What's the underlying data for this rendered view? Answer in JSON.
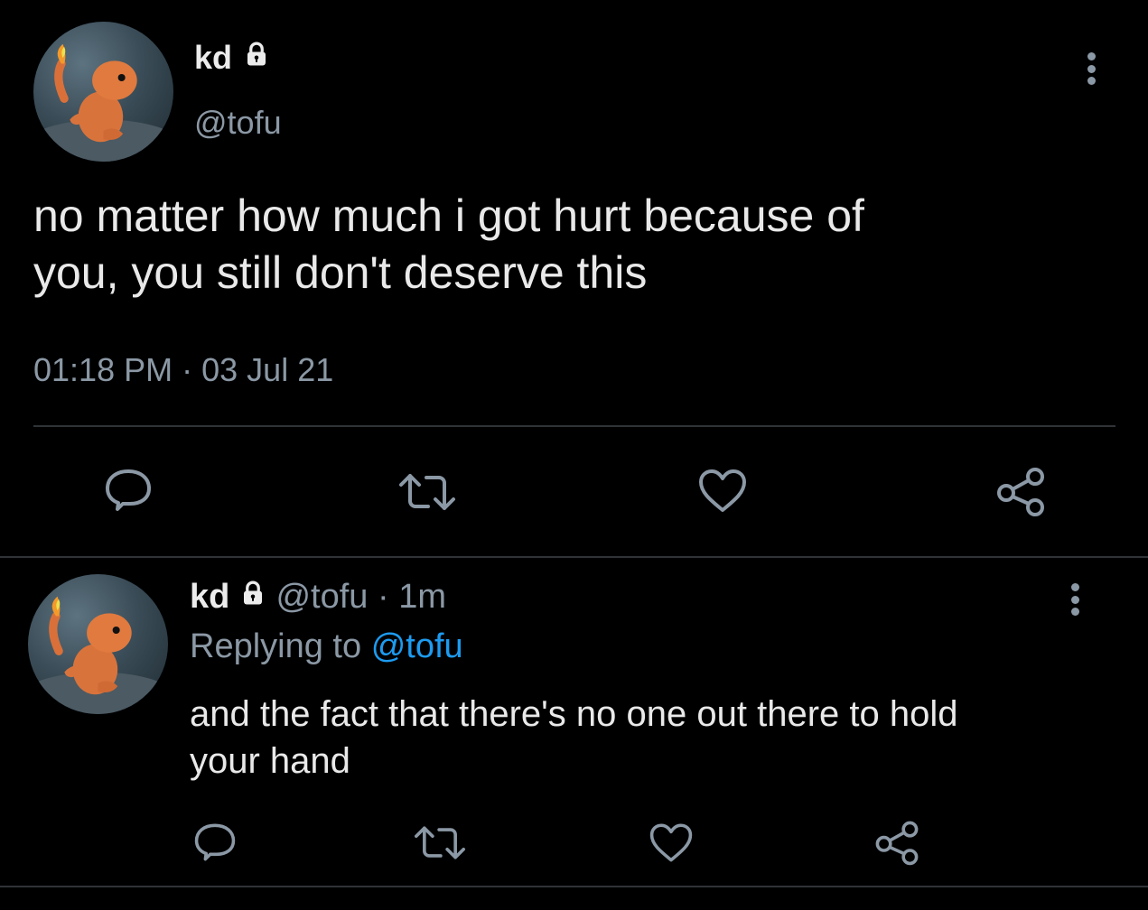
{
  "main_tweet": {
    "display_name": "kd",
    "handle": "@tofu",
    "text_line1": "no matter how much i got hurt because of",
    "text_line2": "you, you still don't deserve this",
    "time": "01:18 PM",
    "separator": "·",
    "date": "03 Jul 21"
  },
  "reply_tweet": {
    "display_name": "kd",
    "handle": "@tofu",
    "separator": "·",
    "age": "1m",
    "replying_prefix": "Replying to",
    "replying_handle": "@tofu",
    "text_line1": "and the fact that there's no one out there to hold",
    "text_line2": "your hand"
  },
  "icons": [
    "lock-icon",
    "more-options-icon",
    "reply-icon",
    "retweet-icon",
    "like-icon",
    "share-icon"
  ],
  "colors": {
    "background": "#000000",
    "text": "#d9d9d9",
    "muted": "#8b98a5",
    "link": "#1d9bf0",
    "divider": "#2f3336"
  }
}
